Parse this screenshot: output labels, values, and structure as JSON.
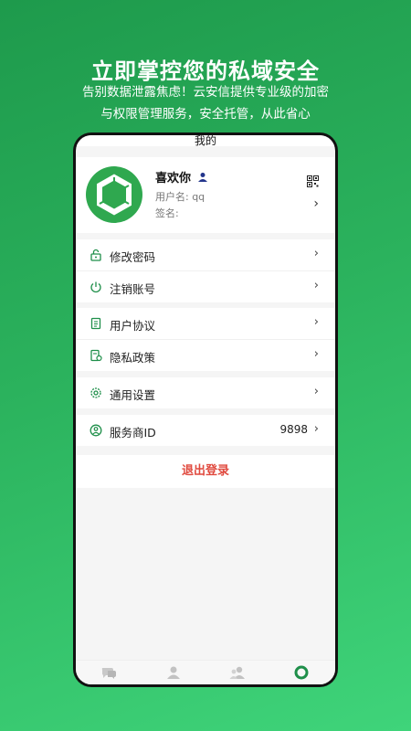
{
  "promo": {
    "headline": "立即掌控您的私域安全",
    "subline1": "告别数据泄露焦虑！云安信提供专业级的加密",
    "subline2": "与权限管理服务，安全托管，从此省心"
  },
  "app": {
    "title": "我的",
    "profile": {
      "name": "喜欢你",
      "username": "用户名: qq",
      "signature": "签名:"
    },
    "menu_groups": [
      {
        "items": [
          {
            "label": "修改密码",
            "icon": "lock-icon"
          },
          {
            "label": "注销账号",
            "icon": "power-icon"
          }
        ]
      },
      {
        "items": [
          {
            "label": "用户协议",
            "icon": "document-icon"
          },
          {
            "label": "隐私政策",
            "icon": "privacy-document-icon"
          }
        ]
      },
      {
        "items": [
          {
            "label": "通用设置",
            "icon": "gear-icon"
          }
        ]
      },
      {
        "items": [
          {
            "label": "服务商ID",
            "icon": "user-circle-icon",
            "value": "9898"
          }
        ]
      }
    ],
    "logout_label": "退出登录",
    "tabs": [
      {
        "icon": "chat-icon",
        "active": false
      },
      {
        "icon": "person-icon",
        "active": false
      },
      {
        "icon": "group-icon",
        "active": false
      },
      {
        "icon": "me-ring-icon",
        "active": true
      }
    ],
    "colors": {
      "accent": "#2fa84f",
      "logout": "#e04a3f",
      "icon_green": "#1f8f4a"
    }
  }
}
